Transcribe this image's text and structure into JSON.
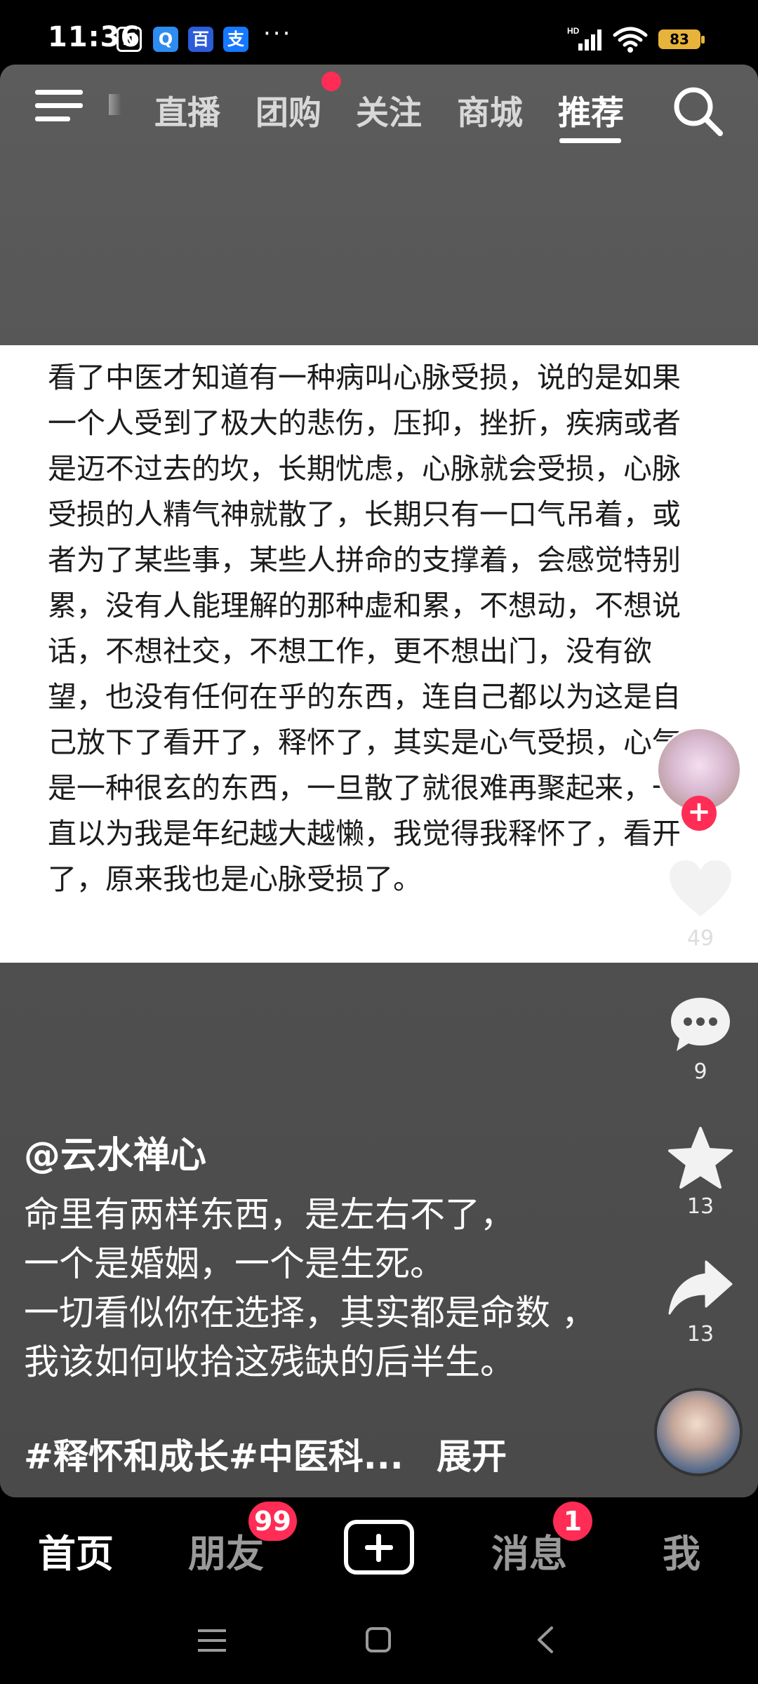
{
  "status_bar": {
    "time": "11:36",
    "app_icons": [
      "N",
      "Q",
      "百",
      "支"
    ],
    "more": "···",
    "network_label": "HD",
    "battery_level": "83"
  },
  "top_nav": {
    "tabs": [
      "直播",
      "团购",
      "关注",
      "商城",
      "推荐"
    ],
    "active_tab": "推荐",
    "groupbuy_has_dot": true
  },
  "post_card": {
    "text": "看了中医才知道有一种病叫心脉受损，说的是如果一个人受到了极大的悲伤，压抑，挫折，疾病或者是迈不过去的坎，长期忧虑，心脉就会受损，心脉受损的人精气神就散了，长期只有一口气吊着，或者为了某些事，某些人拼命的支撑着，会感觉特别累，没有人能理解的那种虚和累，不想动，不想说话，不想社交，不想工作，更不想出门，没有欲望，也没有任何在乎的东西，连自己都以为这是自己放下了看开了，释怀了，其实是心气受损，心气是一种很玄的东西，一旦散了就很难再聚起来，一直以为我是年纪越大越懒，我觉得我释怀了，看开了，原来我也是心脉受损了。"
  },
  "actions": {
    "likes": "49",
    "comments": "9",
    "favorites": "13",
    "shares": "13"
  },
  "caption": {
    "author": "@云水禅心",
    "text": "命里有两样东西，是左右不了，\n一个是婚姻，一个是生死。\n一切看似你在选择，其实都是命数 ，我该如何收拾这残缺的后半生。",
    "hashtags": "#释怀和成长#中医科...",
    "expand_label": "展开"
  },
  "bottom_nav": {
    "home": "首页",
    "friends": "朋友",
    "friends_badge": "99",
    "messages": "消息",
    "messages_badge": "1",
    "me": "我"
  },
  "colors": {
    "accent_red": "#ff2c55",
    "battery": "#e8b33a"
  }
}
